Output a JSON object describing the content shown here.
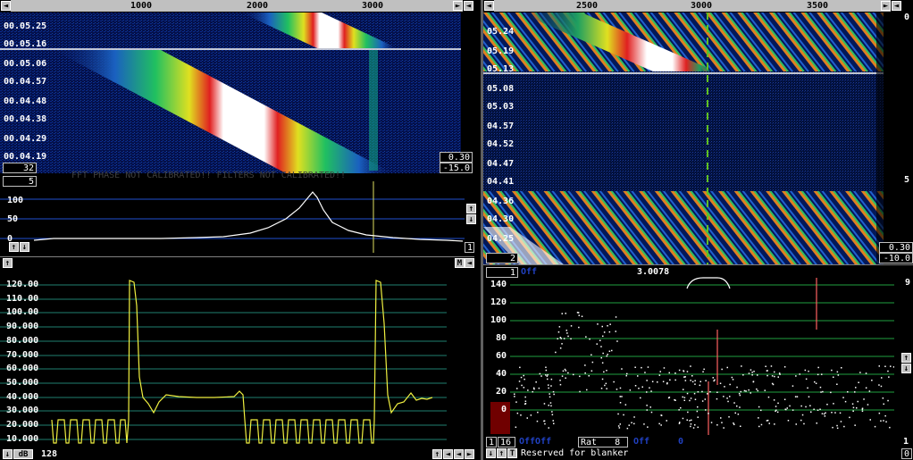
{
  "left_waterfall": {
    "axis_ticks": [
      "1000",
      "2000",
      "3000"
    ],
    "times": [
      "00.05.25",
      "00.05.16",
      "00.05.06",
      "00.04.57",
      "00.04.48",
      "00.04.38",
      "00.04.29",
      "00.04.19"
    ],
    "avg_value": "32",
    "gain_value": "0.30",
    "offset_value": "-15.0",
    "overlay_text": "FFT PHASE NOT CALIBRATED!!    FILTERS NOT CALIBRATED!!"
  },
  "left_spectrum": {
    "box_value": "5",
    "y_labels": [
      "100",
      "50",
      "0"
    ],
    "right_box": "1"
  },
  "baseband": {
    "y_labels": [
      "120.00",
      "110.00",
      "100.00",
      "90.000",
      "80.000",
      "70.000",
      "60.000",
      "50.000",
      "40.000",
      "30.000",
      "20.000",
      "10.000"
    ],
    "m_label": "M",
    "bottom_db": "dB",
    "bottom_value": "128"
  },
  "right_waterfall": {
    "axis_ticks": [
      "2500",
      "3000",
      "3500"
    ],
    "times": [
      "05.24",
      "05.19",
      "05.13",
      "05.08",
      "05.03",
      "04.57",
      "04.52",
      "04.47",
      "04.41",
      "04.36",
      "04.30",
      "04.25"
    ],
    "right_top_a": "0",
    "right_top_b": "5",
    "left_box": "2",
    "gain_value": "0.30",
    "offset_value": "-10.0"
  },
  "right_graph": {
    "box_value": "1",
    "off_label": "Off",
    "freq": "3.0078",
    "right_value": "9",
    "y_labels": [
      "140",
      "120",
      "100",
      "80",
      "60",
      "40",
      "20",
      "0"
    ],
    "bottom_left_a": "1",
    "bottom_left_b": "16",
    "offoff": "OffOff",
    "rat_label": "Rat",
    "rat_value": "8",
    "off2": "Off",
    "off2_value": "0",
    "footer_text": "Reserved for blanker",
    "right_bottom_a": "1",
    "right_bottom_b": "0"
  }
}
